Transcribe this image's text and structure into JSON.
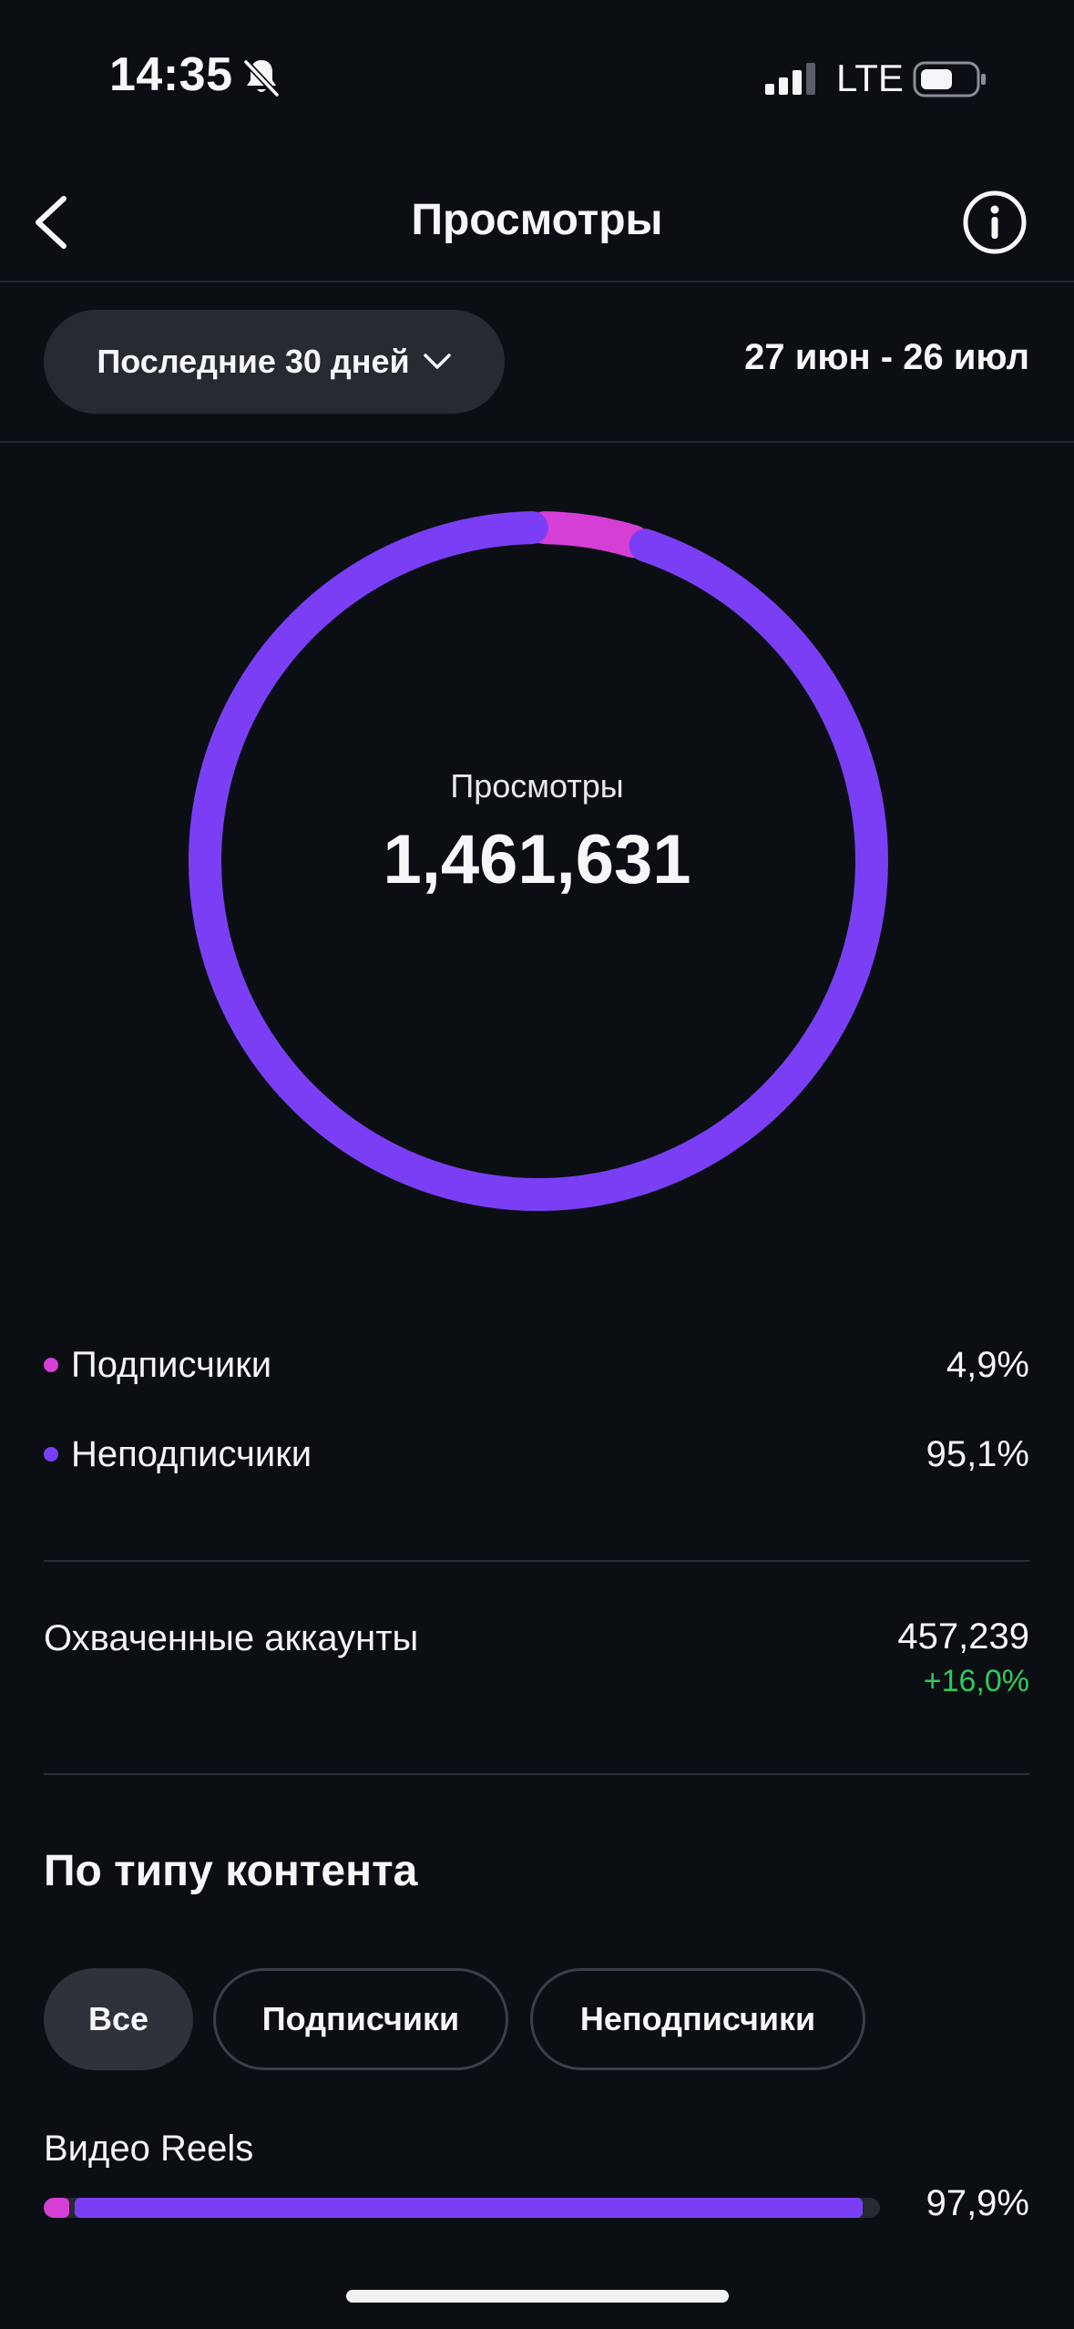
{
  "status_bar": {
    "time": "14:35",
    "network": "LTE",
    "icons": [
      "bell-slash-icon",
      "signal-icon",
      "battery-icon"
    ]
  },
  "header": {
    "title": "Просмотры",
    "back_icon": "chevron-left-icon",
    "info_icon": "info-icon"
  },
  "filters": {
    "range_label": "Последние 30 дней",
    "date_range": "27 июн - 26 июл"
  },
  "summary": {
    "label": "Просмотры",
    "total": "1,461,631"
  },
  "colors": {
    "followers": "#d63fd6",
    "non_followers": "#7a3ff5",
    "positive": "#34c759",
    "background": "#0b0f14"
  },
  "chart_data": {
    "type": "pie",
    "categories": [
      "Подписчики",
      "Неподписчики"
    ],
    "values": [
      4.9,
      95.1
    ],
    "value_labels": [
      "4,9%",
      "95,1%"
    ]
  },
  "audience": {
    "items": [
      {
        "label": "Подписчики",
        "value": "4,9%"
      },
      {
        "label": "Неподписчики",
        "value": "95,1%"
      }
    ]
  },
  "reach": {
    "label": "Охваченные аккаунты",
    "value": "457,239",
    "change": "+16,0%"
  },
  "content_type": {
    "title": "По типу контента",
    "tabs": [
      {
        "label": "Все",
        "active": true
      },
      {
        "label": "Подписчики",
        "active": false
      },
      {
        "label": "Неподписчики",
        "active": false
      }
    ],
    "rows": [
      {
        "label": "Видео Reels",
        "value": "97,9%",
        "share": 0.979,
        "followers_share": 0.049
      }
    ]
  }
}
